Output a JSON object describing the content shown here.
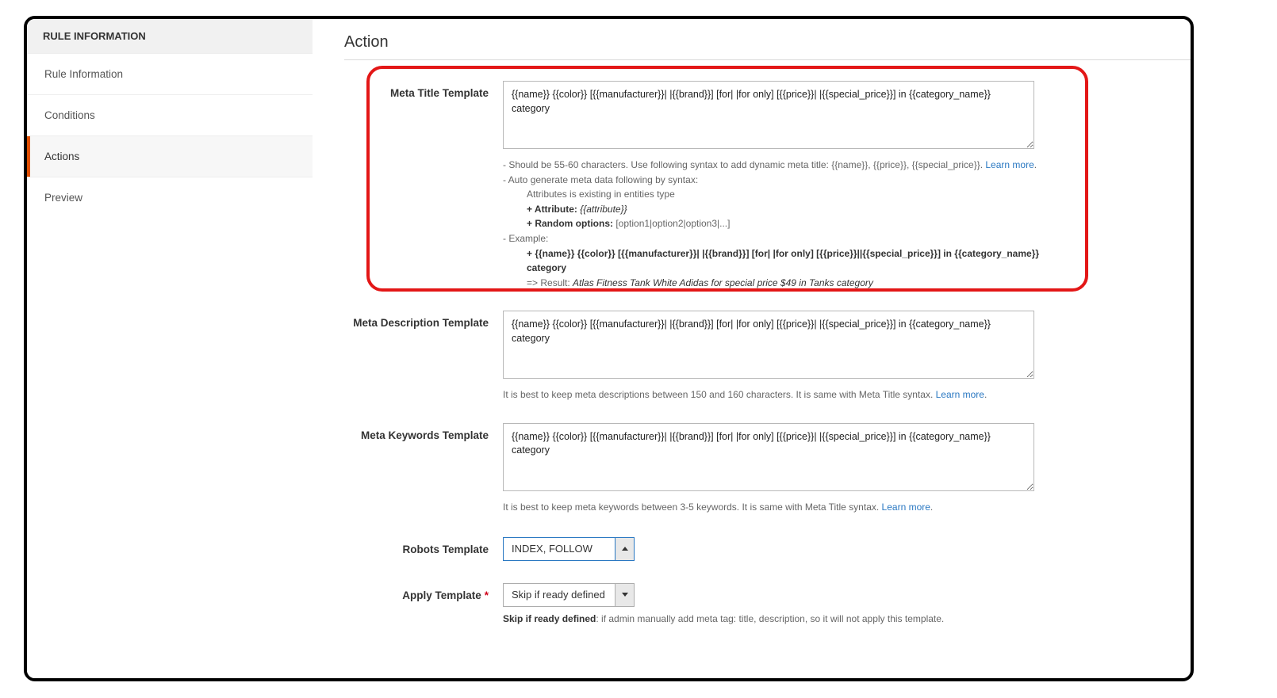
{
  "sidebar": {
    "header": "RULE INFORMATION",
    "items": [
      {
        "label": "Rule Information",
        "active": false
      },
      {
        "label": "Conditions",
        "active": false
      },
      {
        "label": "Actions",
        "active": true
      },
      {
        "label": "Preview",
        "active": false
      }
    ]
  },
  "section_title": "Action",
  "fields": {
    "meta_title": {
      "label": "Meta Title Template",
      "value": "{{name}} {{color}} [{{manufacturer}}| |{{brand}}] [for| |for only] [{{price}}| |{{special_price}}] in {{category_name}} category",
      "help": {
        "line1": "- Should be 55-60 characters. Use following syntax to add dynamic meta title: {{name}}, {{price}}, {{special_price}}. ",
        "learn_more": "Learn more",
        "line2": "- Auto generate meta data following by syntax:",
        "line2a": "Attributes is existing in entities type",
        "line2b_label": "+ Attribute:",
        "line2b_val": " {{attribute}}",
        "line2c_label": "+ Random options:",
        "line2c_val": " [option1|option2|option3|...]",
        "line3": "- Example:",
        "ex_tpl": "+ {{name}} {{color}} [{{manufacturer}}| |{{brand}}] [for| |for only] [{{price}}||{{special_price}}] in {{category_name}} category",
        "ex_res_lbl": "=> Result: ",
        "ex_res_val": "Atlas Fitness Tank White Adidas for special price $49 in Tanks category"
      }
    },
    "meta_desc": {
      "label": "Meta Description Template",
      "value": "{{name}} {{color}} [{{manufacturer}}| |{{brand}}] [for| |for only] [{{price}}| |{{special_price}}] in {{category_name}} category",
      "help_text": "It is best to keep meta descriptions between 150 and 160 characters. It is same with Meta Title syntax. ",
      "learn_more": "Learn more"
    },
    "meta_keywords": {
      "label": "Meta Keywords Template",
      "value": "{{name}} {{color}} [{{manufacturer}}| |{{brand}}] [for| |for only] [{{price}}| |{{special_price}}] in {{category_name}} category",
      "help_text": "It is best to keep meta keywords between 3-5 keywords. It is same with Meta Title syntax. ",
      "learn_more": "Learn more"
    },
    "robots": {
      "label": "Robots Template",
      "value": "INDEX, FOLLOW"
    },
    "apply": {
      "label": "Apply Template",
      "required_star": "*",
      "value": "Skip if ready defined",
      "note_bold": "Skip if ready defined",
      "note_text": ": if admin manually add meta tag: title, description, so it will not apply this template."
    }
  }
}
